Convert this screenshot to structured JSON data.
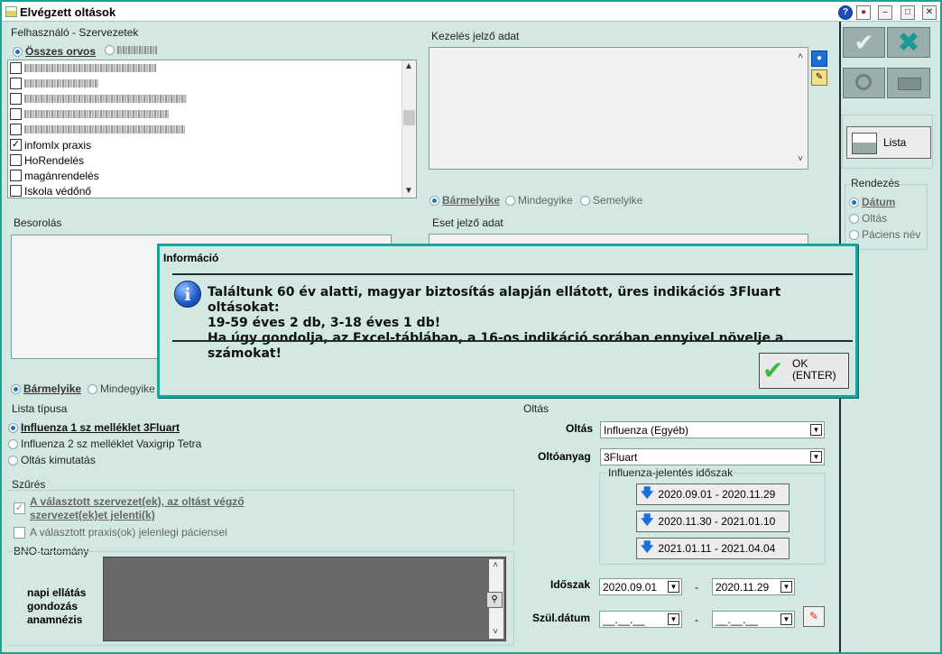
{
  "window": {
    "title": "Elvégzett oltások"
  },
  "left": {
    "group_title": "Felhasználó - Szervezetek",
    "radio_all": "Összes orvos",
    "list_items": [
      {
        "label": "infomIx praxis",
        "checked": true
      },
      {
        "label": "HoRendelés",
        "checked": false
      },
      {
        "label": "magánrendelés",
        "checked": false
      },
      {
        "label": "Iskola védőnő",
        "checked": false
      }
    ],
    "besorolas_title": "Besorolás",
    "match_any": "Bármelyike",
    "match_all": "Mindegyike",
    "match_none": "Semelyike"
  },
  "middle": {
    "kezeles_title": "Kezelés jelző adat",
    "eset_title": "Eset jelző adat"
  },
  "right": {
    "list_button": "Lista",
    "sort_title": "Rendezés",
    "sort_options": [
      "Dátum",
      "Oltás",
      "Páciens név"
    ]
  },
  "lista": {
    "title": "Lista típusa",
    "options": [
      "Influenza 1 sz melléklet 3Fluart",
      "Influenza 2 sz melléklet Vaxigrip Tetra",
      "Oltás kimutatás"
    ]
  },
  "szures": {
    "title": "Szűrés",
    "option1_line1": "A választott szervezet(ek), az oltást végző",
    "option1_line2": "szervezet(ek)et jelenti(k)",
    "option2": "A választott praxis(ok) jelenlegi páciensei"
  },
  "bno": {
    "title": "BNO-tartomány",
    "lines": [
      "napi ellátás",
      "gondozás",
      "anamnézis"
    ]
  },
  "oltas": {
    "title": "Oltás",
    "oltas_label": "Oltás",
    "oltas_value": "Influenza (Egyéb)",
    "oltoanyag_label": "Oltóanyag",
    "oltoanyag_value": "3Fluart",
    "period_title": "Influenza-jelentés időszak",
    "periods": [
      "2020.09.01 - 2020.11.29",
      "2020.11.30 - 2021.01.10",
      "2021.01.11 - 2021.04.04"
    ],
    "idoszak_label": "Időszak",
    "idoszak_from": "2020.09.01",
    "idoszak_to": "2020.11.29",
    "szul_label": "Szül.dátum",
    "szul_from": "__.__.__",
    "szul_to": "__.__.__",
    "dash": "-"
  },
  "dialog": {
    "title": "Információ",
    "line1": "Találtunk 60 év alatti, magyar biztosítás alapján ellátott, üres indikációs 3Fluart oltásokat:",
    "line2": "19-59 éves 2 db, 3-18 éves 1 db!",
    "line3": "Ha úgy gondolja, az Excel-táblában, a 16-os indikáció sorában ennyivel növelje a számokat!",
    "ok_line1": "OK",
    "ok_line2": "(ENTER)"
  },
  "colors": {
    "frame": "#1aa39a",
    "background": "#d3e7e3",
    "accent_blue": "#1b6fd8"
  }
}
